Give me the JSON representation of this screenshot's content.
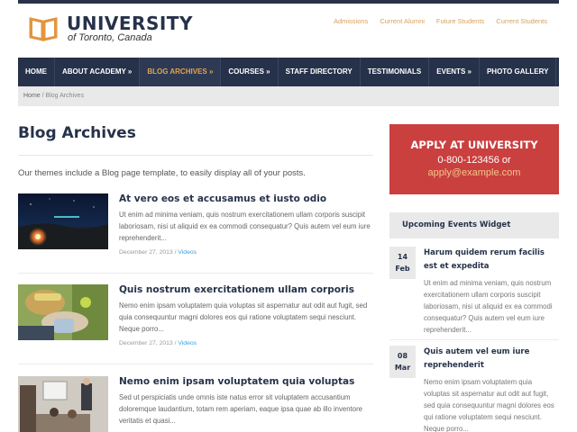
{
  "brand": {
    "title": "UNIVERSITY",
    "subtitle": "of Toronto, Canada"
  },
  "top_links": [
    "Admissions",
    "Current Alumni",
    "Future Students",
    "Current Students"
  ],
  "nav": {
    "items": [
      {
        "label": "HOME"
      },
      {
        "label": "ABOUT ACADEMY »"
      },
      {
        "label": "BLOG ARCHIVES »",
        "active": true
      },
      {
        "label": "COURSES »"
      },
      {
        "label": "STAFF DIRECTORY"
      },
      {
        "label": "TESTIMONIALS"
      },
      {
        "label": "EVENTS »"
      },
      {
        "label": "PHOTO GALLERY"
      }
    ]
  },
  "breadcrumb": {
    "home": "Home",
    "separator": " / ",
    "current": "Blog Archives"
  },
  "page": {
    "title": "Blog Archives",
    "intro": "Our themes include a Blog page template, to easily display all of your posts."
  },
  "posts": [
    {
      "title": "At vero eos et accusamus et iusto odio",
      "excerpt": "Ut enim ad minima veniam, quis nostrum exercitationem ullam corporis suscipit laboriosam, nisi ut aliquid ex ea commodi consequatur? Quis autem vel eum iure reprehenderit...",
      "date": "December 27, 2013",
      "category": "Videos"
    },
    {
      "title": "Quis nostrum exercitationem ullam corporis",
      "excerpt": "Nemo enim ipsam voluptatem quia voluptas sit aspernatur aut odit aut fugit, sed quia consequuntur magni dolores eos qui ratione voluptatem sequi nesciunt. Neque porro...",
      "date": "December 27, 2013",
      "category": "Videos"
    },
    {
      "title": "Nemo enim ipsam voluptatem quia voluptas",
      "excerpt": "Sed ut perspiciatis unde omnis iste natus error sit voluptatem accusantium doloremque laudantium, totam rem aperiam, eaque ipsa quae ab illo inventore veritatis et quasi...",
      "date": "",
      "category": ""
    }
  ],
  "apply": {
    "title": "APPLY AT UNIVERSITY",
    "phone": "0-800-123456 or",
    "email": "apply@example.com"
  },
  "events_widget": {
    "title": "Upcoming Events Widget",
    "events": [
      {
        "day": "14",
        "month": "Feb",
        "title": "Harum quidem rerum facilis est et expedita",
        "excerpt": "Ut enim ad minima veniam, quis nostrum exercitationem ullam corporis suscipit laboriosam, nisi ut aliquid ex ea commodi consequatur? Quis autem vel eum iure reprehenderit..."
      },
      {
        "day": "08",
        "month": "Mar",
        "title": "Quis autem vel eum iure reprehenderit",
        "excerpt": "Nemo enim ipsam voluptatem quia voluptas sit aspernatur aut odit aut fugit, sed quia consequuntur magni dolores eos qui ratione voluptatem sequi nesciunt. Neque porro..."
      }
    ]
  },
  "colors": {
    "navy": "#26324a",
    "accent_orange": "#e3a24f",
    "apply_red": "#c9403f",
    "link_blue": "#3aa0d8"
  }
}
